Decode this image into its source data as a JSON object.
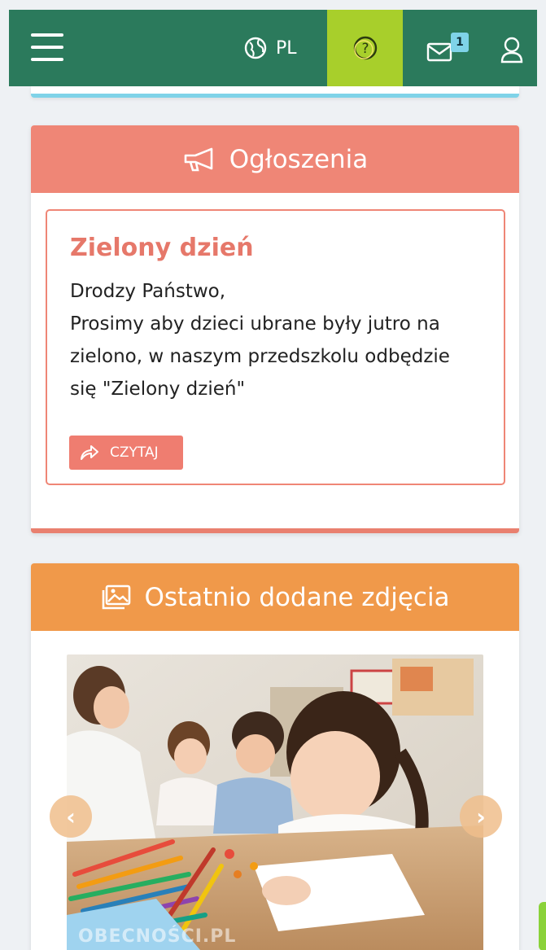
{
  "topbar": {
    "language": "PL",
    "mail_badge": "1",
    "colors": {
      "bar": "#2b7a5c",
      "help": "#a8cf2b",
      "badge": "#7fd3e8"
    }
  },
  "announcements": {
    "header": "Ogłoszenia",
    "notice": {
      "title": "Zielony dzień",
      "greeting": "Drodzy Państwo,",
      "body": "Prosimy aby dzieci ubrane były jutro na zielono, w naszym przedszkolu odbędzie się \"Zielony dzień\"",
      "button": "CZYTAJ"
    }
  },
  "photos": {
    "header": "Ostatnio dodane zdjęcia",
    "caption": "OBECNOŚCI.PL"
  },
  "icons": [
    "menu-icon",
    "globe-icon",
    "help-icon",
    "mail-icon",
    "user-icon",
    "megaphone-icon",
    "share-arrow-icon",
    "gallery-icon",
    "chevron-left-icon",
    "chevron-right-icon"
  ]
}
